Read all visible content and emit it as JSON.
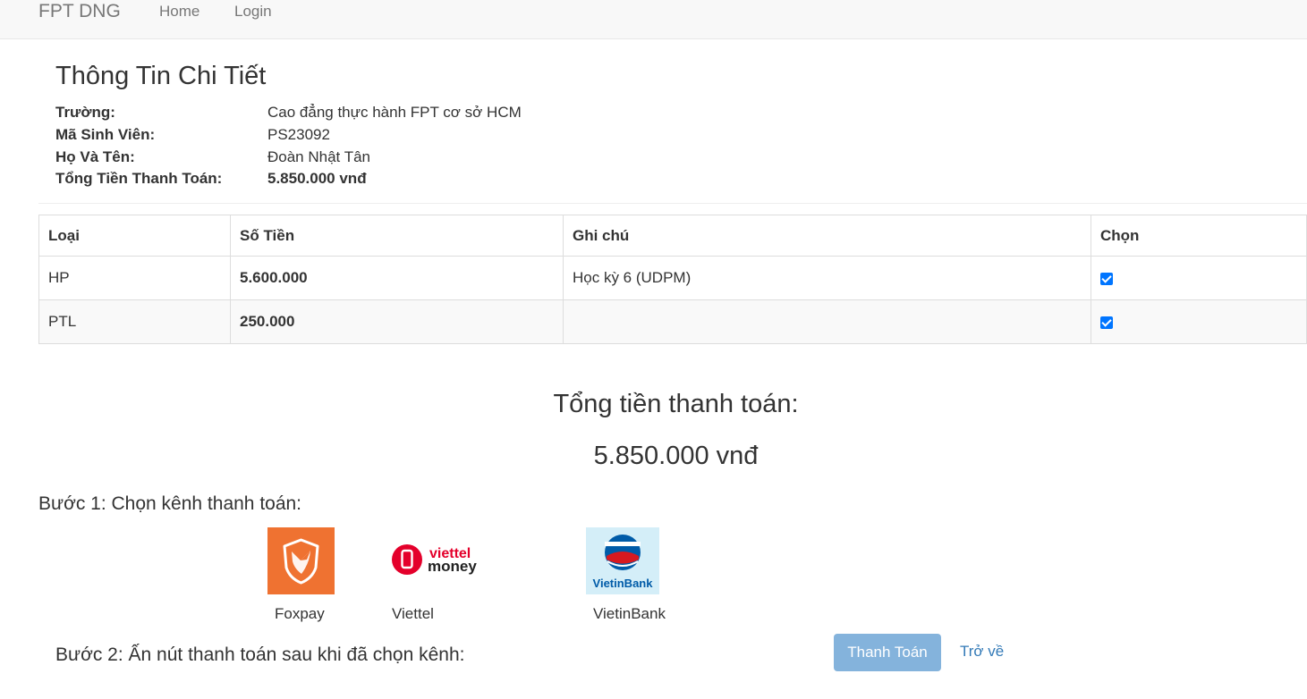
{
  "navbar": {
    "brand": "FPT DNG",
    "home": "Home",
    "login": "Login"
  },
  "info": {
    "title": "Thông Tin Chi Tiết",
    "rows": [
      {
        "label": "Trường:",
        "value": "Cao đẳng thực hành FPT cơ sở HCM"
      },
      {
        "label": "Mã Sinh Viên:",
        "value": "PS23092"
      },
      {
        "label": "Họ Và Tên:",
        "value": "Đoàn Nhật Tân"
      },
      {
        "label": "Tổng Tiền Thanh Toán:",
        "value": "5.850.000 vnđ"
      }
    ]
  },
  "table": {
    "headers": [
      "Loại",
      "Số Tiền",
      "Ghi chú",
      "Chọn"
    ],
    "rows": [
      {
        "type": "HP",
        "amount": "5.600.000",
        "note": "Học kỳ 6 (UDPM)",
        "selected": true
      },
      {
        "type": "PTL",
        "amount": "250.000",
        "note": "",
        "selected": true
      }
    ]
  },
  "total": {
    "label": "Tổng tiền thanh toán:",
    "value": "5.850.000 vnđ"
  },
  "step1": "Bước 1: Chọn kênh thanh toán:",
  "channels": [
    {
      "name": "Foxpay",
      "icon": "foxpay-logo-icon"
    },
    {
      "name": "Viettel",
      "icon": "viettel-money-logo-icon",
      "logo_text_top": "viettel",
      "logo_text_bottom": "money"
    },
    {
      "name": "VietinBank",
      "icon": "vietinbank-logo-icon",
      "logo_text": "VietinBank"
    }
  ],
  "step2": "Bước 2: Ấn nút thanh toán sau khi đã chọn kênh:",
  "buttons": {
    "pay": "Thanh Toán",
    "back": "Trở về"
  },
  "colors": {
    "foxpay": "#ef7231",
    "viettel": "#e4002b",
    "vietin_bg": "#d4eef8",
    "vietin_blue": "#005ba8",
    "vietin_red": "#d71920",
    "pay_button": "#84b3dc",
    "link": "#337ab7"
  }
}
